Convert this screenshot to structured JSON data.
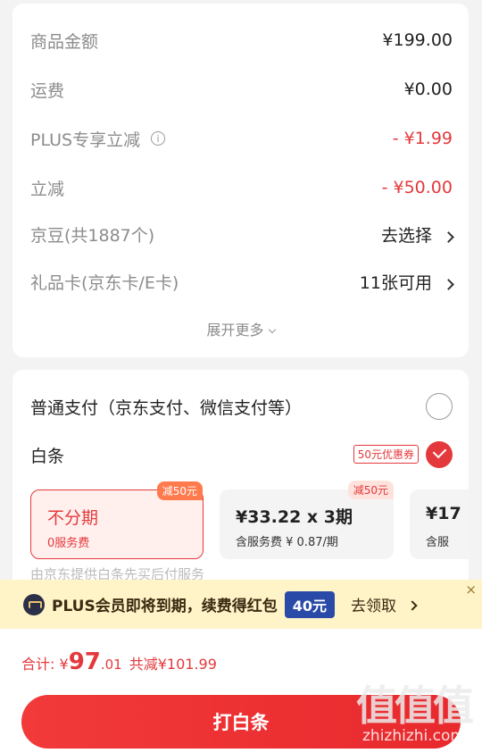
{
  "fees": {
    "rows": [
      {
        "label": "商品金额",
        "value": "¥199.00"
      },
      {
        "label": "运费",
        "value": "¥0.00"
      },
      {
        "label": "PLUS专享立减",
        "value": "- ¥1.99"
      },
      {
        "label": "立减",
        "value": "- ¥50.00"
      },
      {
        "label": "京豆(共1887个)",
        "value": "去选择"
      },
      {
        "label": "礼品卡(京东卡/E卡)",
        "value": "11张可用"
      }
    ],
    "expand_label": "展开更多"
  },
  "payment": {
    "normal_label": "普通支付（京东支付、微信支付等）",
    "baitiao_label": "白条",
    "coupon_tag": "50元优惠券",
    "plans": [
      {
        "title": "不分期",
        "sub": "0服务费",
        "badge": "减50元"
      },
      {
        "title": "¥33.22 x 3期",
        "sub": "含服务费 ¥ 0.87/期",
        "badge": "减50元"
      },
      {
        "title": "¥17",
        "sub": "含服"
      }
    ],
    "faded_text": "由京东提供白条先买后付服务"
  },
  "banner": {
    "text": "PLUS会员即将到期，续费得红包",
    "amount": "40元",
    "cta": "去领取",
    "close": "×"
  },
  "footer": {
    "total_label": "合计:",
    "currency": "¥",
    "total_int": "97",
    "total_dec": ".01",
    "saving": "共减¥101.99",
    "submit_label": "打白条"
  },
  "watermark": {
    "glyphs": "值值值",
    "url": "zhizhizhi.com"
  },
  "colors": {
    "accent": "#e4393c",
    "banner_bg": "#fff3c8",
    "pill": "#2a4aa8"
  }
}
